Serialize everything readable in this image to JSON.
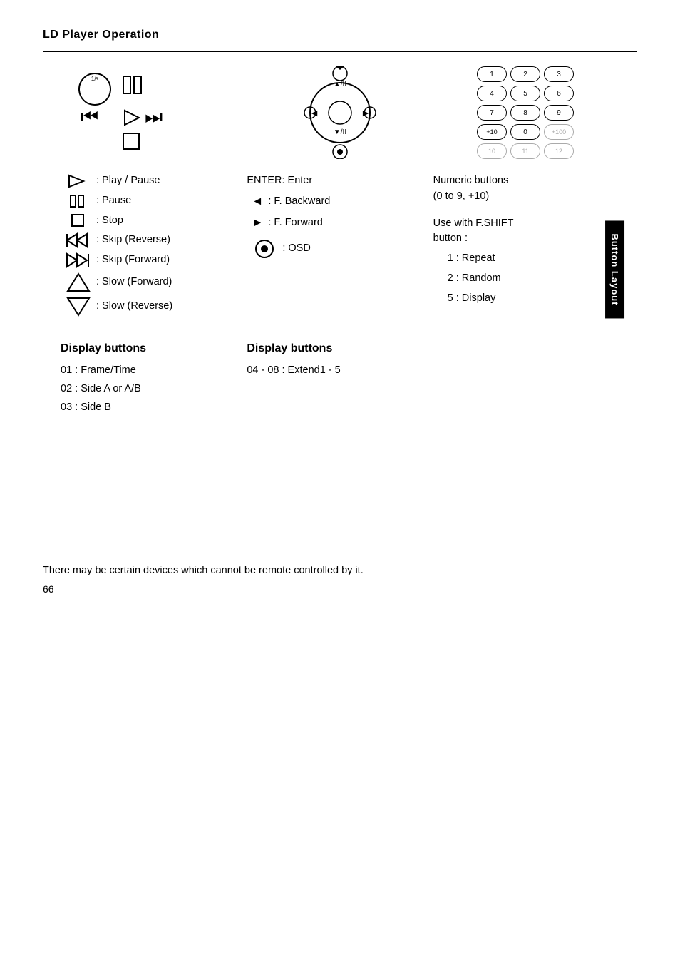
{
  "page": {
    "title": "LD Player Operation",
    "sidebar_tab": "Button Layout",
    "page_number": "66",
    "footer_note": "There may be certain devices which cannot be remote controlled by it."
  },
  "descriptions": {
    "col1": [
      {
        "icon": "play-icon",
        "text": ": Play / Pause"
      },
      {
        "icon": "pause-icon",
        "text": ": Pause"
      },
      {
        "icon": "stop-icon",
        "text": ": Stop"
      },
      {
        "icon": "skip-reverse-icon",
        "text": ": Skip (Reverse)"
      },
      {
        "icon": "skip-forward-icon",
        "text": ": Skip (Forward)"
      },
      {
        "icon": "slow-forward-icon",
        "text": ": Slow (Forward)"
      },
      {
        "icon": "slow-reverse-icon",
        "text": ": Slow (Reverse)"
      }
    ],
    "col2": [
      {
        "icon": "enter-label",
        "text": "ENTER: Enter"
      },
      {
        "icon": "f-backward-icon",
        "text": ": F. Backward"
      },
      {
        "icon": "f-forward-icon",
        "text": ": F. Forward"
      },
      {
        "icon": "osd-icon",
        "text": ": OSD"
      }
    ],
    "col3_title": "Numeric buttons\n(0 to 9, +10)",
    "col3_extra_title": "Use with F.SHIFT button :",
    "col3_extra_items": [
      "1 : Repeat",
      "2 : Random",
      "5 : Display"
    ]
  },
  "display_buttons_left": {
    "title": "Display buttons",
    "items": [
      "01  : Frame/Time",
      "02  : Side A or A/B",
      "03  : Side B"
    ]
  },
  "display_buttons_right": {
    "title": "Display buttons",
    "items": [
      "04 - 08 : Extend1 - 5"
    ]
  },
  "numeric_buttons": {
    "rows": [
      [
        "1",
        "2",
        "3"
      ],
      [
        "4",
        "5",
        "6"
      ],
      [
        "7",
        "8",
        "9"
      ],
      [
        "+10",
        "0",
        "+100"
      ],
      [
        "10",
        "11",
        "12"
      ]
    ],
    "dim_row": 4
  }
}
